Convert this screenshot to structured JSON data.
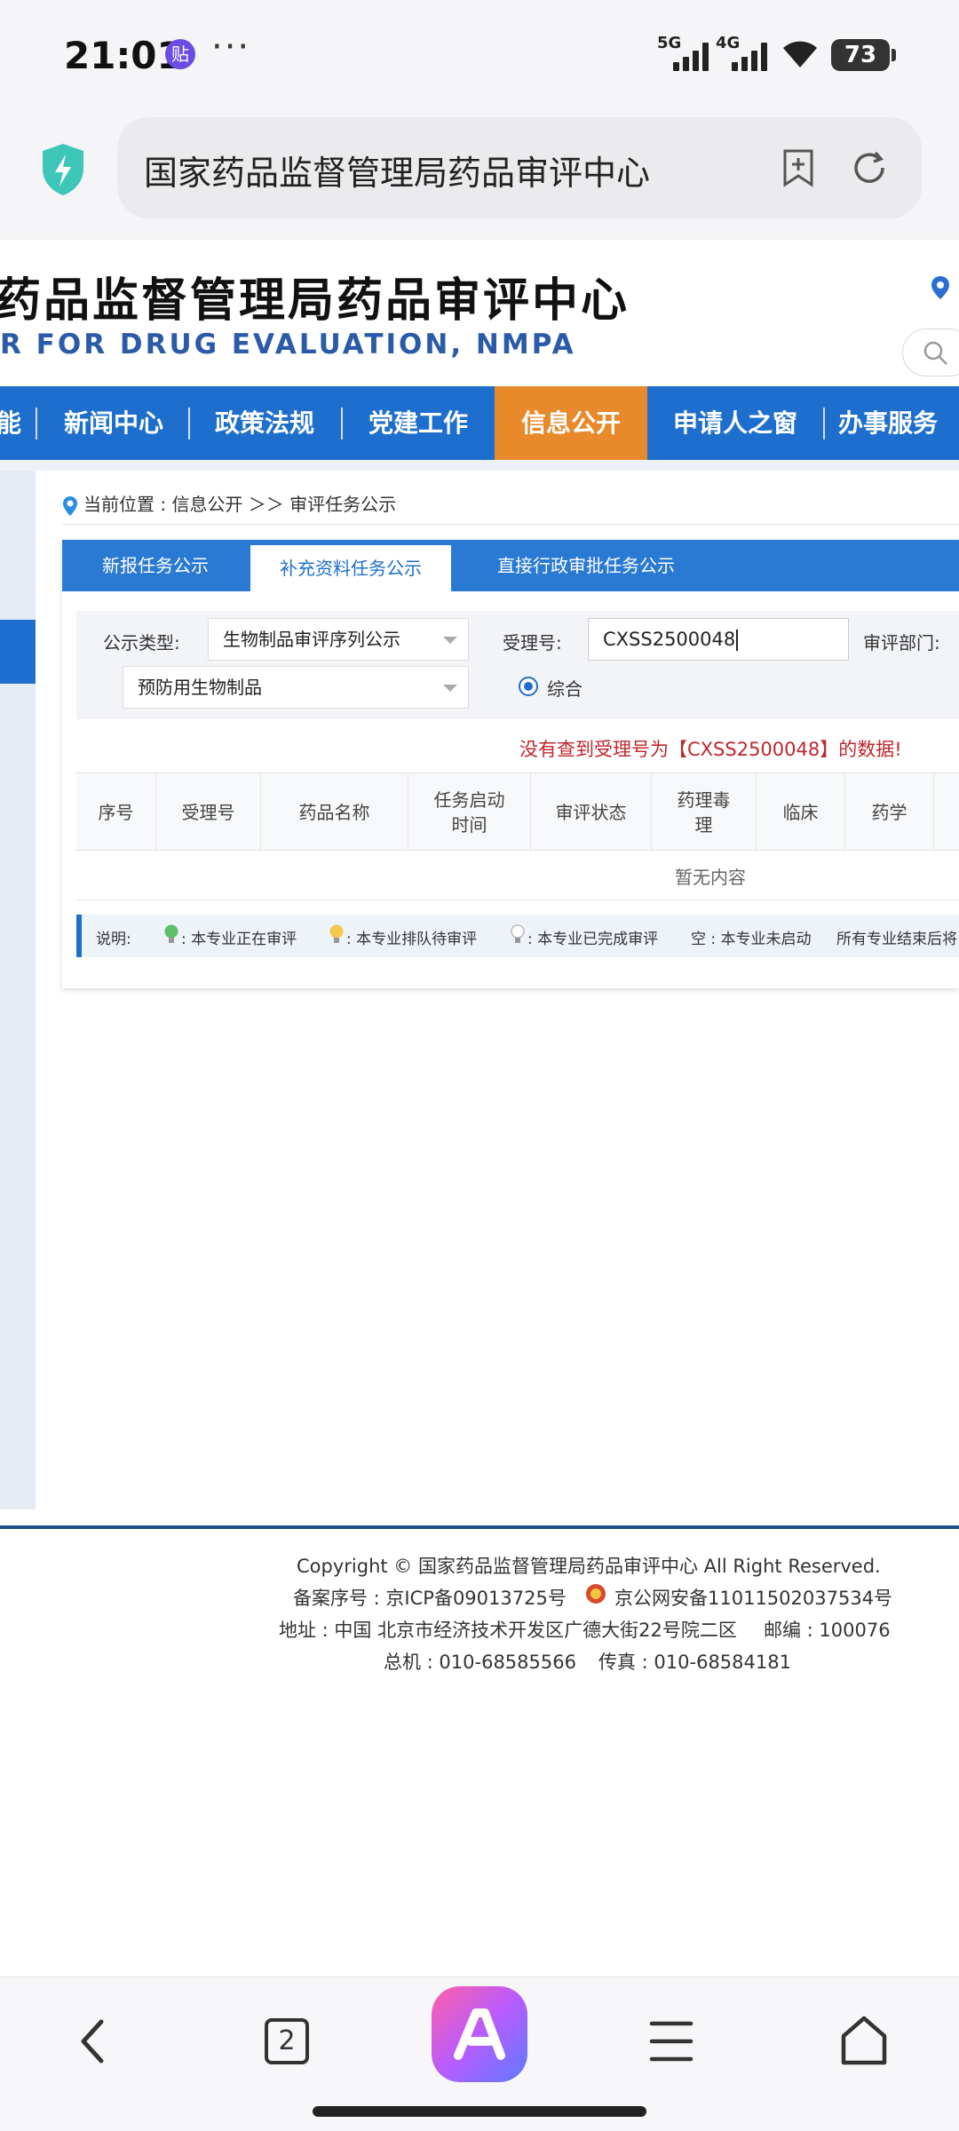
{
  "status_bar": {
    "time": "21:01",
    "note_icon_text": "贴",
    "more_dots": "···",
    "signal_5g": "5G",
    "signal_4g": "4G",
    "battery": "73"
  },
  "browser": {
    "url_title": "国家药品监督管理局药品审评中心",
    "icons": [
      "shield-icon",
      "bookmark-add-icon",
      "refresh-icon"
    ]
  },
  "site": {
    "title_cn": "药品监督管理局药品审评中心",
    "title_en": "R FOR DRUG EVALUATION, NMPA"
  },
  "nav": {
    "items": [
      {
        "label": "能"
      },
      {
        "label": "新闻中心"
      },
      {
        "label": "政策法规"
      },
      {
        "label": "党建工作"
      },
      {
        "label": "信息公开"
      },
      {
        "label": "申请人之窗"
      },
      {
        "label": "办事服务"
      }
    ],
    "active_index": 4,
    "active_color": "#e8892b",
    "bar_color": "#1e6fcd"
  },
  "breadcrumb": {
    "text": "当前位置 : 信息公开 ＞＞ 审评任务公示"
  },
  "tabs": [
    {
      "label": "新报任务公示"
    },
    {
      "label": "补充资料任务公示"
    },
    {
      "label": "直接行政审批任务公示"
    }
  ],
  "filter": {
    "type_label": "公示类型:",
    "type_value": "生物制品审评序列公示",
    "subtype_value": "预防用生物制品",
    "accept_label": "受理号:",
    "accept_value": "CXSS2500048",
    "dept_label": "审评部门:",
    "radio_label": "综合"
  },
  "error_message": "没有查到受理号为【CXSS2500048】的数据!",
  "table": {
    "columns": [
      "序号",
      "受理号",
      "药品名称",
      "任务启动\n时间",
      "审评状态",
      "药理毒\n理",
      "临床",
      "药学"
    ],
    "empty_text": "暂无内容"
  },
  "legend": {
    "prefix": "说明:",
    "items": [
      {
        "icon": "green-bulb-icon",
        "text": ": 本专业正在审评"
      },
      {
        "icon": "yellow-bulb-icon",
        "text": ": 本专业排队待审评"
      },
      {
        "icon": "white-bulb-icon",
        "text": ": 本专业已完成审评"
      },
      {
        "icon": "",
        "text": "空 : 本专业未启动"
      },
      {
        "icon": "",
        "text": "所有专业结束后将"
      }
    ]
  },
  "footer": {
    "copyright": "Copyright © 国家药品监督管理局药品审评中心   All Right Reserved.",
    "icp": "备案序号 : 京ICP备09013725号",
    "police": "京公网安备11011502037534号",
    "address": "地址 : 中国  北京市经济技术开发区广德大街22号院二区",
    "postcode": "邮编 : 100076",
    "phone": "总机 : 010-68585566",
    "fax": "传真 : 010-68584181"
  },
  "bottom_nav": {
    "tab_count": "2",
    "icons": [
      "back-icon",
      "tabs-icon",
      "app-logo-icon",
      "menu-icon",
      "home-icon"
    ]
  }
}
